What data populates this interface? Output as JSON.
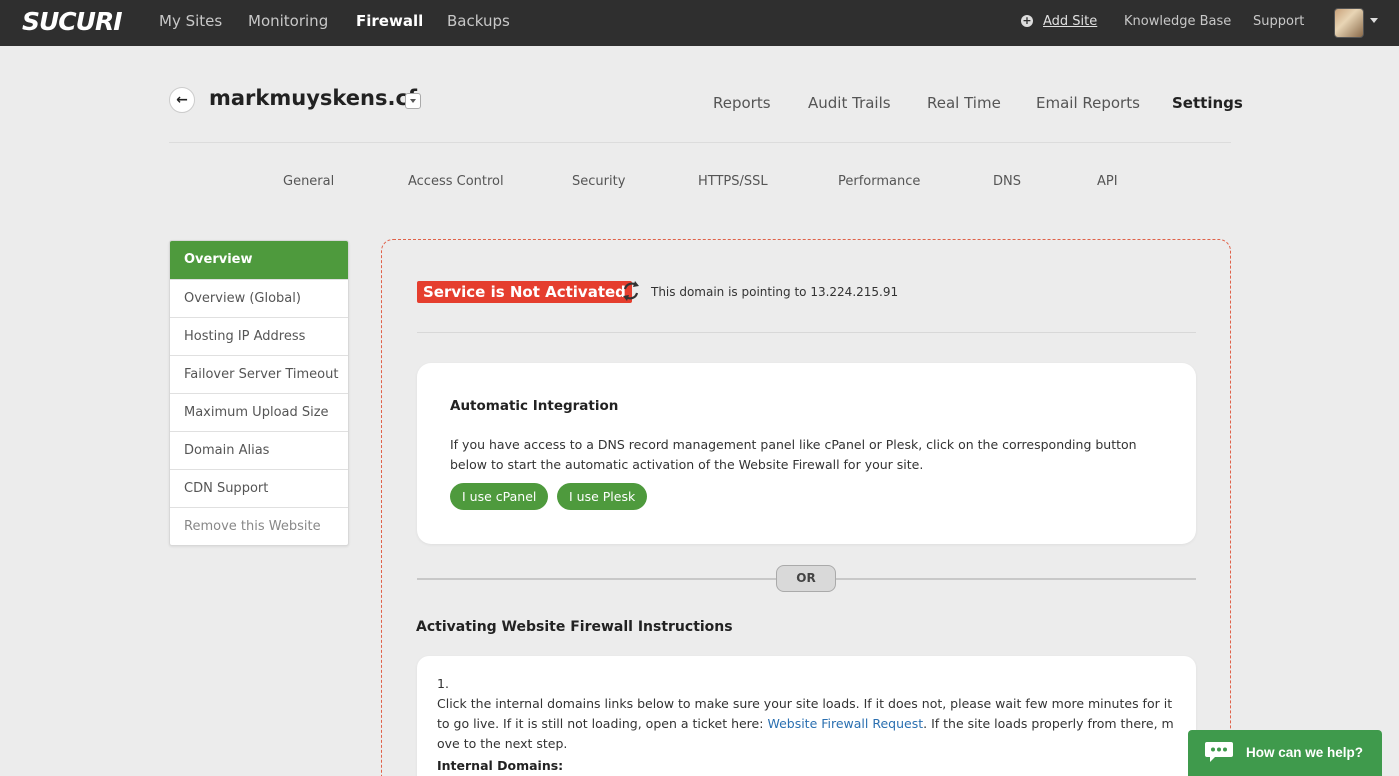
{
  "topbar": {
    "logo": "SUCURI",
    "nav": [
      "My Sites",
      "Monitoring",
      "Firewall",
      "Backups"
    ],
    "active_nav": "Firewall",
    "add_site": "Add Site",
    "knowledge_base": "Knowledge Base",
    "support": "Support"
  },
  "site": {
    "title": "markmuyskens.cf",
    "nav": [
      "Reports",
      "Audit Trails",
      "Real Time",
      "Email Reports",
      "Settings"
    ],
    "active_nav": "Settings"
  },
  "subtabs": [
    "General",
    "Access Control",
    "Security",
    "HTTPS/SSL",
    "Performance",
    "DNS",
    "API"
  ],
  "sidebar": {
    "items": [
      "Overview",
      "Overview (Global)",
      "Hosting IP Address",
      "Failover Server Timeout",
      "Maximum Upload Size",
      "Domain Alias",
      "CDN Support",
      "Remove this Website"
    ],
    "active": "Overview"
  },
  "status": {
    "badge": "Service is Not Activated",
    "badge_color": "#e53e2e",
    "pointing": "This domain is pointing to 13.224.215.91"
  },
  "integration": {
    "title": "Automatic Integration",
    "text": "If you have access to a DNS record management panel like cPanel or Plesk, click on the corresponding button below to start the automatic activation of the Website Firewall for your site.",
    "cpanel_button": "I use cPanel",
    "plesk_button": "I use Plesk"
  },
  "divider": {
    "label": "OR"
  },
  "instructions": {
    "title": "Activating Website Firewall Instructions",
    "step_number": "1.",
    "step_text_before": "Click the internal domains links below to make sure your site loads. If it does not, please wait few more minutes for it to go live. If it is still not loading, open a ticket here: ",
    "step_link": "Website Firewall Request",
    "step_text_after": ". If the site loads properly from there, move to the next step.",
    "internal_domains": "Internal Domains:"
  },
  "chat": {
    "label": "How can we help?"
  },
  "colors": {
    "accent_green": "#4e9a3d",
    "topbar": "#2f2f2f",
    "chat_green": "#3f9a4c"
  }
}
